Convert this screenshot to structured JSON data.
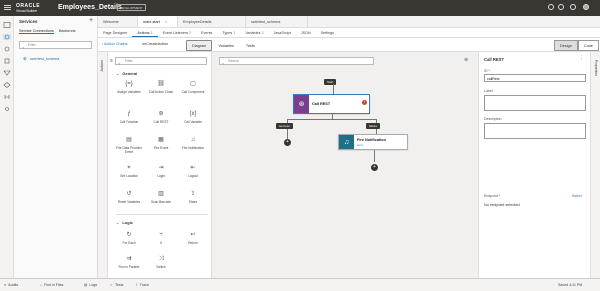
{
  "header": {
    "brand_line1": "ORACLE",
    "brand_line2": "Visual Builder",
    "app_title": "Employees_Details",
    "env_badge": "DEVELOPMENT"
  },
  "services": {
    "title": "Services",
    "subtabs": [
      "Service Connections",
      "Backends"
    ],
    "filter_placeholder": "Filter",
    "connection": "swb/test_schema"
  },
  "tabs": [
    {
      "label": "Welcome"
    },
    {
      "label": "main-start"
    },
    {
      "label": "EmployeeDetails"
    },
    {
      "label": "swb/test_schema"
    }
  ],
  "subnav": [
    "Page Designer",
    "Actions",
    "Event Listeners",
    "Events",
    "Types",
    "Variables",
    "JavaScript",
    "JSON",
    "Settings"
  ],
  "subnav_counts": {
    "Actions": "1",
    "Event Listeners": "2",
    "Types": "1",
    "Variables": "3"
  },
  "toolbar": {
    "back": "Action Chains",
    "chain": "onCreateAction",
    "buttons": [
      "Diagram",
      "Variables",
      "Tests"
    ],
    "design": "Design",
    "code": "Code"
  },
  "actions_strip": "Actions",
  "properties_strip": "Properties",
  "palette": {
    "filter_placeholder": "Filter",
    "general_title": "General",
    "general": [
      {
        "label": "Assign Variables",
        "icon": "assign-icon"
      },
      {
        "label": "Call Action Chain",
        "icon": "chain-icon"
      },
      {
        "label": "Call Component",
        "icon": "component-icon"
      },
      {
        "label": "Call Function",
        "icon": "function-icon"
      },
      {
        "label": "Call REST",
        "icon": "rest-icon"
      },
      {
        "label": "Call Variable",
        "icon": "variable-icon"
      },
      {
        "label": "Fire Data Provider Event",
        "icon": "data-provider-icon"
      },
      {
        "label": "Fire Event",
        "icon": "event-icon"
      },
      {
        "label": "Fire Notification",
        "icon": "bell-icon"
      },
      {
        "label": "Get Location",
        "icon": "location-icon"
      },
      {
        "label": "Login",
        "icon": "login-icon"
      },
      {
        "label": "Logout",
        "icon": "logout-icon"
      },
      {
        "label": "Reset Variables",
        "icon": "reset-icon"
      },
      {
        "label": "Scan Barcode",
        "icon": "barcode-icon"
      },
      {
        "label": "Share",
        "icon": "share-icon"
      }
    ],
    "logic_title": "Logic",
    "logic": [
      {
        "label": "For Each",
        "icon": "foreach-icon"
      },
      {
        "label": "If",
        "icon": "if-icon"
      },
      {
        "label": "Return",
        "icon": "return-icon"
      },
      {
        "label": "Run in Parallel",
        "icon": "parallel-icon"
      },
      {
        "label": "Switch",
        "icon": "switch-icon"
      }
    ]
  },
  "canvas": {
    "search_placeholder": "Search",
    "start": "Start",
    "rest_node": {
      "title": "Call REST"
    },
    "success": "success",
    "failure": "failure",
    "notif_node": {
      "title": "Fire Notification",
      "sub": "error"
    }
  },
  "properties": {
    "title": "Call REST",
    "id_label": "ID *",
    "id_value": "callRest",
    "label_label": "Label",
    "desc_label": "Description",
    "endpoint_label": "Endpoint *",
    "select_link": "Select",
    "endpoint_value": "No endpoint selected"
  },
  "status": {
    "audits": "Audits",
    "find": "Find in Files",
    "logs": "Logs",
    "tests": "Tests",
    "trace": "Trace",
    "saved": "Saved 4:11 PM",
    "audit_count": "0"
  }
}
